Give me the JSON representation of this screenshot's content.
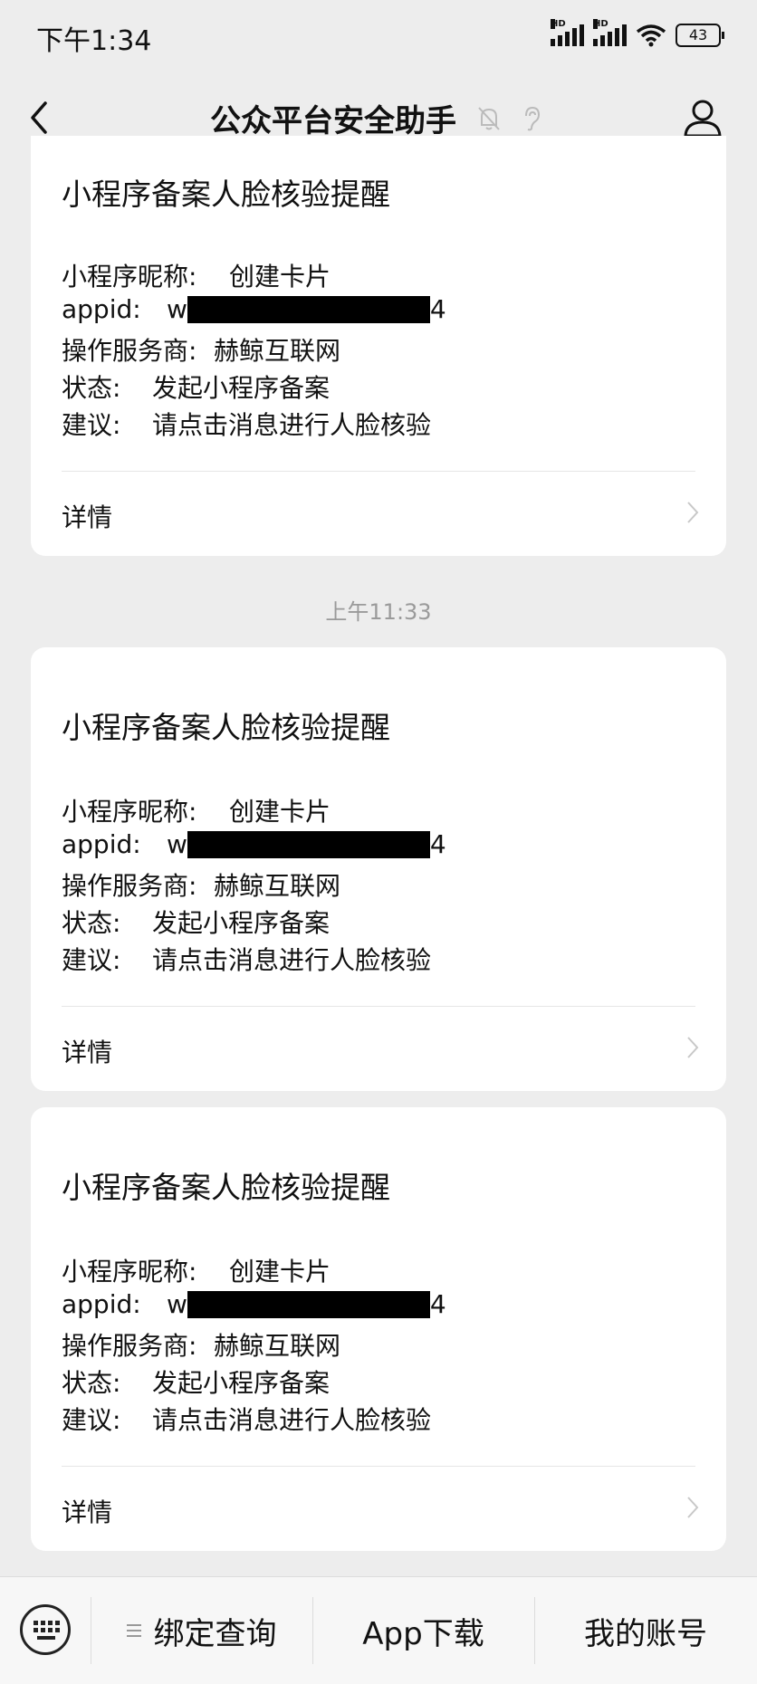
{
  "status_bar": {
    "time": "下午1:34",
    "battery": "43",
    "signal1_label": "HD",
    "signal2_label": "HD"
  },
  "nav": {
    "title": "公众平台安全助手"
  },
  "timestamp": "上午11:33",
  "cards": [
    {
      "title": "小程序备案人脸核验提醒",
      "nickname_label": "小程序昵称:",
      "nickname_value": "创建卡片",
      "appid_label": "appid:",
      "appid_prefix": "w",
      "appid_suffix": "4",
      "provider_label": "操作服务商:",
      "provider_value": "赫鲸互联网",
      "status_label": "状态:",
      "status_value": "发起小程序备案",
      "suggest_label": "建议:",
      "suggest_value": "请点击消息进行人脸核验",
      "detail_label": "详情"
    },
    {
      "title": "小程序备案人脸核验提醒",
      "nickname_label": "小程序昵称:",
      "nickname_value": "创建卡片",
      "appid_label": "appid:",
      "appid_prefix": "w",
      "appid_suffix": "4",
      "provider_label": "操作服务商:",
      "provider_value": "赫鲸互联网",
      "status_label": "状态:",
      "status_value": "发起小程序备案",
      "suggest_label": "建议:",
      "suggest_value": "请点击消息进行人脸核验",
      "detail_label": "详情"
    },
    {
      "title": "小程序备案人脸核验提醒",
      "nickname_label": "小程序昵称:",
      "nickname_value": "创建卡片",
      "appid_label": "appid:",
      "appid_prefix": "w",
      "appid_suffix": "4",
      "provider_label": "操作服务商:",
      "provider_value": "赫鲸互联网",
      "status_label": "状态:",
      "status_value": "发起小程序备案",
      "suggest_label": "建议:",
      "suggest_value": "请点击消息进行人脸核验",
      "detail_label": "详情"
    }
  ],
  "bottom_menu": {
    "item1": "绑定查询",
    "item2": "App下载",
    "item3": "我的账号"
  }
}
